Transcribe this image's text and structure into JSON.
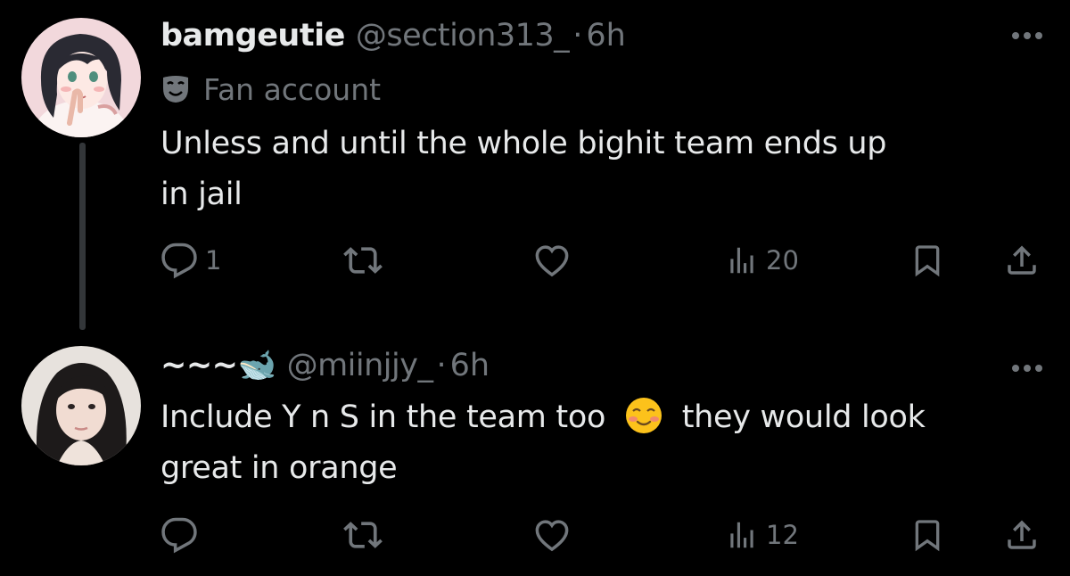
{
  "tweets": [
    {
      "display_name": "bamgeutie",
      "handle": "@section313_",
      "separator": "·",
      "time": "6h",
      "label": "Fan account",
      "text_lines": [
        "Unless and until the whole bighit team ends up",
        "in jail"
      ],
      "replies": "1",
      "views": "20",
      "avatar": "avatar-drawn-girl"
    },
    {
      "display_name": "~~~🐋",
      "handle": "@miinjjy_",
      "separator": "·",
      "time": "6h",
      "text_before_emoji": "Include Y n S in the team too",
      "emoji": "smiling-face-emoji",
      "text_after_emoji": "they would look",
      "text_line_2": "great in orange",
      "replies": "",
      "views": "12",
      "avatar": "avatar-photo-girl"
    }
  ],
  "icons": [
    "more-icon",
    "reply-icon",
    "retweet-icon",
    "like-icon",
    "views-icon",
    "bookmark-icon",
    "share-icon",
    "theater-mask-icon"
  ],
  "colors": {
    "background": "#000000",
    "text": "#e7e9ea",
    "secondary": "#71767b",
    "thread_line": "#333639"
  }
}
